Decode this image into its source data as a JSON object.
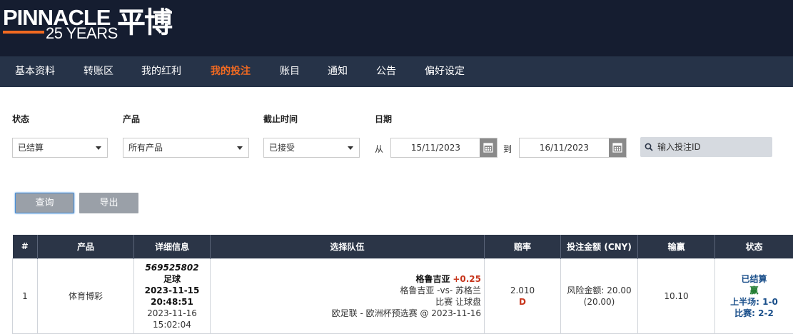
{
  "header": {
    "logo_main": "PINNACLE",
    "logo_years": "25 YEARS",
    "logo_cn": "平博"
  },
  "nav": {
    "items": [
      {
        "label": "基本资料"
      },
      {
        "label": "转账区"
      },
      {
        "label": "我的红利"
      },
      {
        "label": "我的投注",
        "active": true
      },
      {
        "label": "账目"
      },
      {
        "label": "通知"
      },
      {
        "label": "公告"
      },
      {
        "label": "偏好设定"
      }
    ]
  },
  "filters": {
    "status_label": "状态",
    "status_value": "已结算",
    "product_label": "产品",
    "product_value": "所有产品",
    "cutoff_label": "截止时间",
    "cutoff_value": "已接受",
    "date_label": "日期",
    "from_label": "从",
    "from_value": "15/11/2023",
    "to_label": "到",
    "to_value": "16/11/2023",
    "search_placeholder": "输入投注ID"
  },
  "buttons": {
    "query": "查询",
    "export": "导出"
  },
  "table": {
    "headers": [
      "#",
      "产品",
      "详细信息",
      "选择队伍",
      "赔率",
      "投注金额 (CNY)",
      "输赢",
      "状态"
    ],
    "rows": [
      {
        "index": "1",
        "product": "体育博彩",
        "bet_id": "569525802",
        "sport": "足球",
        "placed_date": "2023-11-15",
        "placed_time": "20:48:51",
        "event_date": "2023-11-16",
        "event_time": "15:02:04",
        "selection": "格鲁吉亚",
        "handicap": "+0.25",
        "match": "格鲁吉亚 -vs- 苏格兰",
        "market": "比赛 让球盘",
        "league": "欧足联 - 欧洲杯预选赛 @ 2023-11-16",
        "odds": "2.010",
        "odds_format": "D",
        "stake": "风险金额: 20.00",
        "stake_sub": "(20.00)",
        "win_loss": "10.10",
        "status": "已结算",
        "result": "赢",
        "half_time": "上半场: 1-0",
        "full_time": "比赛: 2-2"
      }
    ]
  },
  "colors": {
    "header_bg": "#151d30",
    "nav_bg": "#263348",
    "accent": "#f26a21",
    "table_header_bg": "#2b3547",
    "status_blue": "#1a4f8a",
    "win_green": "#1e7a2e"
  }
}
